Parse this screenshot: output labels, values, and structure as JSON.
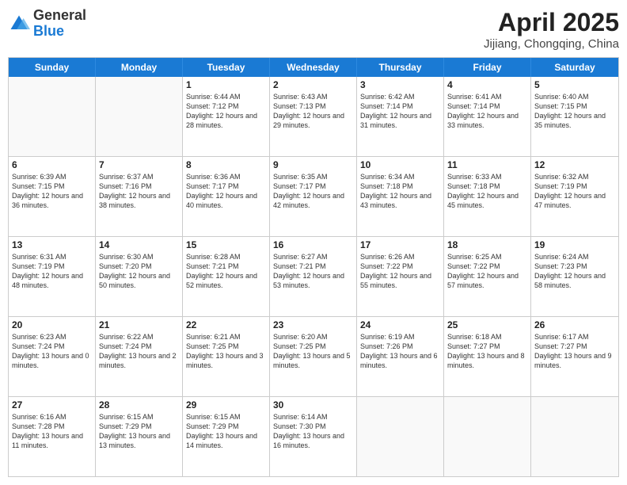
{
  "header": {
    "logo": {
      "general": "General",
      "blue": "Blue"
    },
    "title": "April 2025",
    "subtitle": "Jijiang, Chongqing, China"
  },
  "calendar": {
    "days_of_week": [
      "Sunday",
      "Monday",
      "Tuesday",
      "Wednesday",
      "Thursday",
      "Friday",
      "Saturday"
    ],
    "rows": [
      [
        {
          "day": "",
          "empty": true
        },
        {
          "day": "",
          "empty": true
        },
        {
          "day": "1",
          "sunrise": "Sunrise: 6:44 AM",
          "sunset": "Sunset: 7:12 PM",
          "daylight": "Daylight: 12 hours and 28 minutes."
        },
        {
          "day": "2",
          "sunrise": "Sunrise: 6:43 AM",
          "sunset": "Sunset: 7:13 PM",
          "daylight": "Daylight: 12 hours and 29 minutes."
        },
        {
          "day": "3",
          "sunrise": "Sunrise: 6:42 AM",
          "sunset": "Sunset: 7:14 PM",
          "daylight": "Daylight: 12 hours and 31 minutes."
        },
        {
          "day": "4",
          "sunrise": "Sunrise: 6:41 AM",
          "sunset": "Sunset: 7:14 PM",
          "daylight": "Daylight: 12 hours and 33 minutes."
        },
        {
          "day": "5",
          "sunrise": "Sunrise: 6:40 AM",
          "sunset": "Sunset: 7:15 PM",
          "daylight": "Daylight: 12 hours and 35 minutes."
        }
      ],
      [
        {
          "day": "6",
          "sunrise": "Sunrise: 6:39 AM",
          "sunset": "Sunset: 7:15 PM",
          "daylight": "Daylight: 12 hours and 36 minutes."
        },
        {
          "day": "7",
          "sunrise": "Sunrise: 6:37 AM",
          "sunset": "Sunset: 7:16 PM",
          "daylight": "Daylight: 12 hours and 38 minutes."
        },
        {
          "day": "8",
          "sunrise": "Sunrise: 6:36 AM",
          "sunset": "Sunset: 7:17 PM",
          "daylight": "Daylight: 12 hours and 40 minutes."
        },
        {
          "day": "9",
          "sunrise": "Sunrise: 6:35 AM",
          "sunset": "Sunset: 7:17 PM",
          "daylight": "Daylight: 12 hours and 42 minutes."
        },
        {
          "day": "10",
          "sunrise": "Sunrise: 6:34 AM",
          "sunset": "Sunset: 7:18 PM",
          "daylight": "Daylight: 12 hours and 43 minutes."
        },
        {
          "day": "11",
          "sunrise": "Sunrise: 6:33 AM",
          "sunset": "Sunset: 7:18 PM",
          "daylight": "Daylight: 12 hours and 45 minutes."
        },
        {
          "day": "12",
          "sunrise": "Sunrise: 6:32 AM",
          "sunset": "Sunset: 7:19 PM",
          "daylight": "Daylight: 12 hours and 47 minutes."
        }
      ],
      [
        {
          "day": "13",
          "sunrise": "Sunrise: 6:31 AM",
          "sunset": "Sunset: 7:19 PM",
          "daylight": "Daylight: 12 hours and 48 minutes."
        },
        {
          "day": "14",
          "sunrise": "Sunrise: 6:30 AM",
          "sunset": "Sunset: 7:20 PM",
          "daylight": "Daylight: 12 hours and 50 minutes."
        },
        {
          "day": "15",
          "sunrise": "Sunrise: 6:28 AM",
          "sunset": "Sunset: 7:21 PM",
          "daylight": "Daylight: 12 hours and 52 minutes."
        },
        {
          "day": "16",
          "sunrise": "Sunrise: 6:27 AM",
          "sunset": "Sunset: 7:21 PM",
          "daylight": "Daylight: 12 hours and 53 minutes."
        },
        {
          "day": "17",
          "sunrise": "Sunrise: 6:26 AM",
          "sunset": "Sunset: 7:22 PM",
          "daylight": "Daylight: 12 hours and 55 minutes."
        },
        {
          "day": "18",
          "sunrise": "Sunrise: 6:25 AM",
          "sunset": "Sunset: 7:22 PM",
          "daylight": "Daylight: 12 hours and 57 minutes."
        },
        {
          "day": "19",
          "sunrise": "Sunrise: 6:24 AM",
          "sunset": "Sunset: 7:23 PM",
          "daylight": "Daylight: 12 hours and 58 minutes."
        }
      ],
      [
        {
          "day": "20",
          "sunrise": "Sunrise: 6:23 AM",
          "sunset": "Sunset: 7:24 PM",
          "daylight": "Daylight: 13 hours and 0 minutes."
        },
        {
          "day": "21",
          "sunrise": "Sunrise: 6:22 AM",
          "sunset": "Sunset: 7:24 PM",
          "daylight": "Daylight: 13 hours and 2 minutes."
        },
        {
          "day": "22",
          "sunrise": "Sunrise: 6:21 AM",
          "sunset": "Sunset: 7:25 PM",
          "daylight": "Daylight: 13 hours and 3 minutes."
        },
        {
          "day": "23",
          "sunrise": "Sunrise: 6:20 AM",
          "sunset": "Sunset: 7:25 PM",
          "daylight": "Daylight: 13 hours and 5 minutes."
        },
        {
          "day": "24",
          "sunrise": "Sunrise: 6:19 AM",
          "sunset": "Sunset: 7:26 PM",
          "daylight": "Daylight: 13 hours and 6 minutes."
        },
        {
          "day": "25",
          "sunrise": "Sunrise: 6:18 AM",
          "sunset": "Sunset: 7:27 PM",
          "daylight": "Daylight: 13 hours and 8 minutes."
        },
        {
          "day": "26",
          "sunrise": "Sunrise: 6:17 AM",
          "sunset": "Sunset: 7:27 PM",
          "daylight": "Daylight: 13 hours and 9 minutes."
        }
      ],
      [
        {
          "day": "27",
          "sunrise": "Sunrise: 6:16 AM",
          "sunset": "Sunset: 7:28 PM",
          "daylight": "Daylight: 13 hours and 11 minutes."
        },
        {
          "day": "28",
          "sunrise": "Sunrise: 6:15 AM",
          "sunset": "Sunset: 7:29 PM",
          "daylight": "Daylight: 13 hours and 13 minutes."
        },
        {
          "day": "29",
          "sunrise": "Sunrise: 6:15 AM",
          "sunset": "Sunset: 7:29 PM",
          "daylight": "Daylight: 13 hours and 14 minutes."
        },
        {
          "day": "30",
          "sunrise": "Sunrise: 6:14 AM",
          "sunset": "Sunset: 7:30 PM",
          "daylight": "Daylight: 13 hours and 16 minutes."
        },
        {
          "day": "",
          "empty": true
        },
        {
          "day": "",
          "empty": true
        },
        {
          "day": "",
          "empty": true
        }
      ]
    ]
  }
}
